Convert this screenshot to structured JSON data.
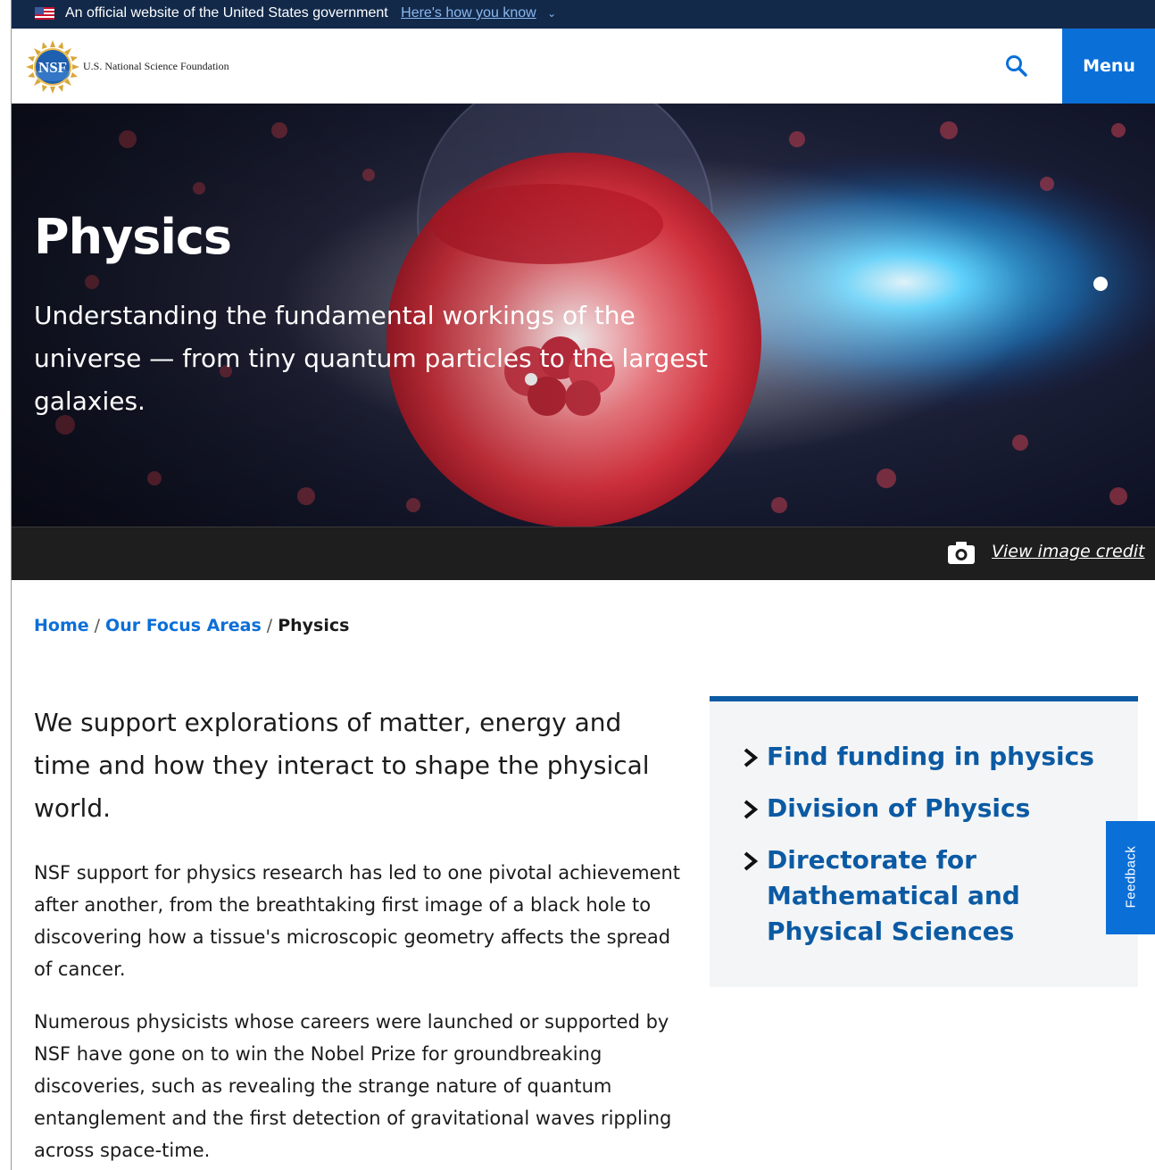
{
  "gov_banner": {
    "text": "An official website of the United States government",
    "link": "Here's how you know"
  },
  "header": {
    "logo_text": "NSF",
    "org_name": "U.S. National Science Foundation",
    "menu_label": "Menu"
  },
  "hero": {
    "title": "Physics",
    "subtitle": "Understanding the fundamental workings of the universe — from tiny quantum particles to the largest galaxies.",
    "credit_link": "View image credit"
  },
  "breadcrumb": {
    "home": "Home",
    "focus": "Our Focus Areas",
    "current": "Physics",
    "separator": "/"
  },
  "main": {
    "lead": "We support explorations of matter, energy and time and how they interact to shape the physical world.",
    "para1": "NSF support for physics research has led to one pivotal achievement after another, from the breathtaking first image of a black hole to discovering how a tissue's microscopic geometry affects the spread of cancer.",
    "para2": "Numerous physicists whose careers were launched or supported by NSF have gone on to win the Nobel Prize for groundbreaking discoveries, such as revealing the strange nature of quantum entanglement and the first detection of gravitational waves rippling across space-time."
  },
  "sidebar": {
    "links": [
      "Find funding in physics",
      "Division of Physics",
      "Directorate for Mathematical and Physical Sciences"
    ]
  },
  "feedback": {
    "label": "Feedback"
  },
  "colors": {
    "gov_banner_bg": "#12294a",
    "primary_blue": "#0b6fd8",
    "link_blue": "#0b5aa3",
    "hero_bg": "#151a2e",
    "sidebar_bg": "#f4f5f6"
  },
  "icons": [
    "us-flag-icon",
    "nsf-logo",
    "search-icon",
    "camera-icon",
    "chevron-right-icon",
    "chevron-down-icon"
  ]
}
